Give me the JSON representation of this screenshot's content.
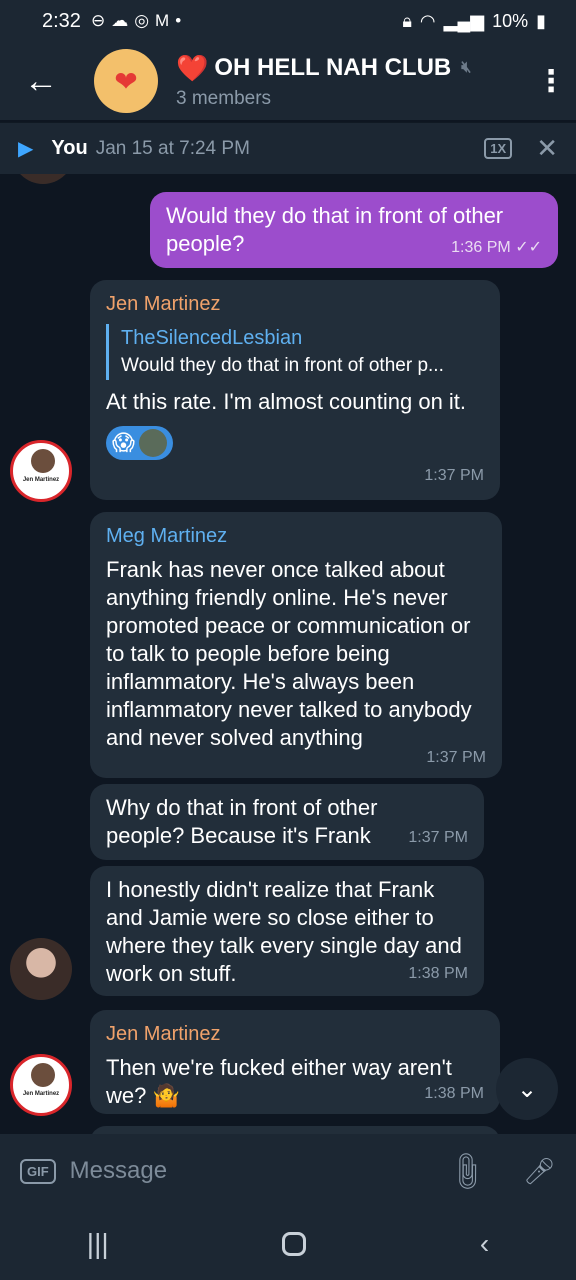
{
  "status_bar": {
    "time": "2:32",
    "notif_icons": [
      "⊖",
      "☁",
      "◎",
      "M",
      "•"
    ],
    "battery": "10%"
  },
  "header": {
    "title": "OH HELL NAH CLUB",
    "members": "3 members",
    "avatar_emoji": "❤",
    "title_emoji": "❤️"
  },
  "player": {
    "name": "You",
    "date": "Jan 15 at 7:24 PM",
    "speed": "1X"
  },
  "messages": [
    {
      "type": "out",
      "text": "Would they do that in front of other people?",
      "time": "1:36 PM",
      "status": "✓✓"
    },
    {
      "type": "in",
      "sender": "Jen Martinez",
      "reply_to": {
        "name": "TheSilencedLesbian",
        "text": "Would they do that in front of other p..."
      },
      "text": "At this rate. I'm almost counting on it.",
      "reaction": "😱",
      "time": "1:37 PM"
    },
    {
      "type": "in",
      "sender": "Meg Martinez",
      "text": "Frank has never once talked about anything friendly online. He's never promoted peace or communication or to talk to people before being inflammatory. He's always been inflammatory never talked to anybody and never solved anything",
      "time": "1:37 PM"
    },
    {
      "type": "in",
      "text": "Why do that in front of other people? Because it's Frank",
      "time": "1:37 PM"
    },
    {
      "type": "in",
      "text": "I honestly didn't realize that Frank and Jamie were so close either to where they talk every single day and work on stuff.",
      "time": "1:38 PM"
    },
    {
      "type": "in",
      "sender": "Jen Martinez",
      "text": "Then we're fucked either way aren't we? 🤷",
      "time": "1:38 PM"
    }
  ],
  "avatar_label": "Jen Martinez",
  "input": {
    "gif": "GIF",
    "placeholder": "Message"
  },
  "nav": {
    "recents": "|||",
    "back": "‹"
  }
}
